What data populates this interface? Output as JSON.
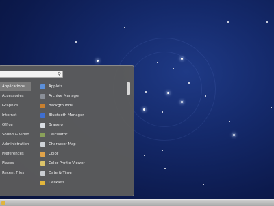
{
  "search": {
    "placeholder": ""
  },
  "categories": [
    {
      "label": "Applications",
      "active": true
    },
    {
      "label": "Accessories"
    },
    {
      "label": "Graphics"
    },
    {
      "label": "Internet"
    },
    {
      "label": "Office"
    },
    {
      "label": "Sound & Video"
    },
    {
      "label": "Administration"
    },
    {
      "label": "Preferences"
    },
    {
      "label": "Places"
    },
    {
      "label": "Recent Files"
    }
  ],
  "apps": [
    {
      "label": "Applets",
      "icon": "applets-icon",
      "color": "#5b8fd9"
    },
    {
      "label": "Archive Manager",
      "icon": "archive-manager-icon",
      "color": "#8a8f97"
    },
    {
      "label": "Backgrounds",
      "icon": "backgrounds-icon",
      "color": "#c8802f"
    },
    {
      "label": "Bluetooth Manager",
      "icon": "bluetooth-icon",
      "color": "#3f6fd0"
    },
    {
      "label": "Brasero",
      "icon": "brasero-icon",
      "color": "#d9dde3"
    },
    {
      "label": "Calculator",
      "icon": "calculator-icon",
      "color": "#8aa15a"
    },
    {
      "label": "Character Map",
      "icon": "character-map-icon",
      "color": "#cfd3d8"
    },
    {
      "label": "Color",
      "icon": "color-icon",
      "color": "#e0a34a"
    },
    {
      "label": "Color Profile Viewer",
      "icon": "color-profile-viewer-icon",
      "color": "#dcc46a"
    },
    {
      "label": "Date & Time",
      "icon": "date-time-icon",
      "color": "#c9cdd2"
    },
    {
      "label": "Desklets",
      "icon": "desklets-icon",
      "color": "#e2b53c"
    }
  ]
}
